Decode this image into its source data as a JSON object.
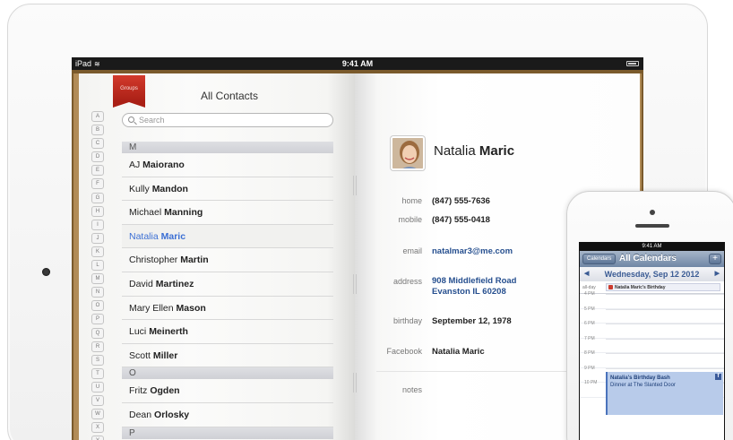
{
  "ipad_status": {
    "carrier": "iPad",
    "wifi": "≋",
    "time": "9:41 AM"
  },
  "groups_label": "Groups",
  "list_title": "All Contacts",
  "search_placeholder": "Search",
  "alpha_index": [
    "A",
    "B",
    "C",
    "D",
    "E",
    "F",
    "G",
    "H",
    "I",
    "J",
    "K",
    "L",
    "M",
    "N",
    "O",
    "P",
    "Q",
    "R",
    "S",
    "T",
    "U",
    "V",
    "W",
    "X",
    "Y"
  ],
  "sections": [
    {
      "letter": "M",
      "rows": [
        {
          "first": "AJ ",
          "last": "Maiorano",
          "selected": false
        },
        {
          "first": "Kully ",
          "last": "Mandon",
          "selected": false
        },
        {
          "first": "Michael ",
          "last": "Manning",
          "selected": false
        },
        {
          "first": "Natalia ",
          "last": "Maric",
          "selected": true
        },
        {
          "first": "Christopher ",
          "last": "Martin",
          "selected": false
        },
        {
          "first": "David ",
          "last": "Martinez",
          "selected": false
        },
        {
          "first": "Mary Ellen ",
          "last": "Mason",
          "selected": false
        },
        {
          "first": "Luci ",
          "last": "Meinerth",
          "selected": false
        },
        {
          "first": "Scott ",
          "last": "Miller",
          "selected": false
        }
      ]
    },
    {
      "letter": "O",
      "rows": [
        {
          "first": "Fritz ",
          "last": "Ogden",
          "selected": false
        },
        {
          "first": "Dean ",
          "last": "Orlosky",
          "selected": false
        }
      ]
    },
    {
      "letter": "P",
      "rows": []
    }
  ],
  "contact": {
    "first": "Natalia",
    "last": " Maric",
    "home_label": "home",
    "home_value": "(847) 555-7636",
    "mobile_label": "mobile",
    "mobile_value": "(847) 555-0418",
    "email_label": "email",
    "email_value": "natalmar3@me.com",
    "address_label": "address",
    "address_line1": "908 Middlefield Road",
    "address_line2": "Evanston IL 60208",
    "birthday_label": "birthday",
    "birthday_value": "September 12, 1978",
    "facebook_label": "Facebook",
    "facebook_value": "Natalia Maric",
    "notes_label": "notes"
  },
  "iphone": {
    "time": "9:41 AM",
    "calendars_button": "Calendars",
    "title": "All Calendars",
    "add_button": "+",
    "prev_arrow": "◀",
    "next_arrow": "▶",
    "date": "Wednesday, Sep 12 2012",
    "allday_label": "all-day",
    "allday_event": "Natalia Maric's Birthday",
    "hours": [
      "4 PM",
      "5 PM",
      "6 PM",
      "7 PM",
      "8 PM",
      "9 PM",
      "10 PM"
    ],
    "event_title": "Natalia's Birthday Bash",
    "event_location": "Dinner at The Slanted Door",
    "event_badge": "f"
  },
  "colors": {
    "selected_text": "#3b6fd4",
    "ribbon": "#c3301f",
    "event_fill": "#b8cbea"
  }
}
